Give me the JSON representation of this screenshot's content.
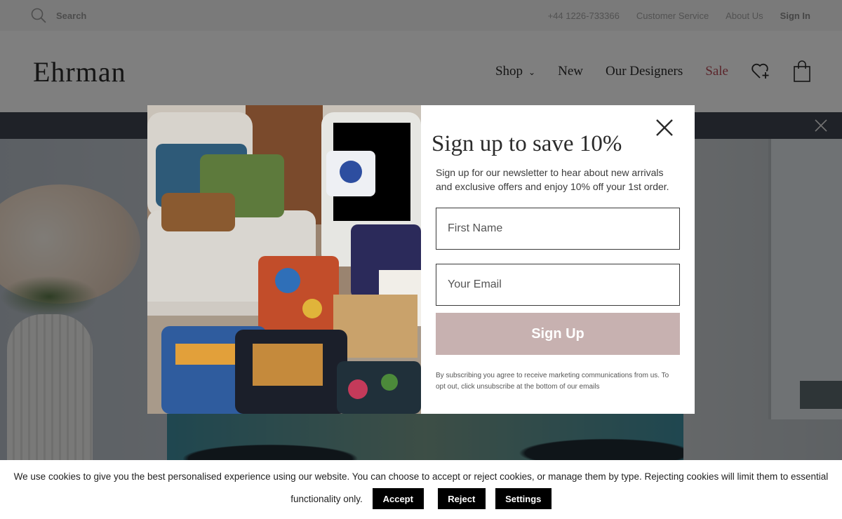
{
  "topbar": {
    "search_label": "Search",
    "phone": "+44 1226-733366",
    "customer_service": "Customer Service",
    "about_us": "About Us",
    "sign_in": "Sign In"
  },
  "header": {
    "logo": "Ehrman",
    "nav": {
      "shop": "Shop",
      "new": "New",
      "designers": "Our Designers",
      "sale": "Sale"
    },
    "icons": [
      "search-icon",
      "chevron-down-icon",
      "heart-plus-icon",
      "shopping-bag-icon",
      "close-icon"
    ]
  },
  "modal": {
    "title": "Sign up to save 10%",
    "subtitle": "Sign up for our newsletter to hear about new arrivals and exclusive offers and enjoy 10% off your 1st order.",
    "first_name_placeholder": "First Name",
    "email_placeholder": "Your Email",
    "signup_label": "Sign Up",
    "fineprint": "By subscribing you agree to receive marketing communications from us. To opt out, click unsubscribe at the bottom of our emails"
  },
  "cookie": {
    "text_line1": "We use cookies to give you the best personalised experience using our website. You can choose to accept or reject cookies, or manage them by type. Rejecting cookies will limit them to essential",
    "text_line2": "functionality only.",
    "accept": "Accept",
    "reject": "Reject",
    "settings": "Settings"
  },
  "colors": {
    "sale": "#b74b56",
    "signup_button": "#c7b1b0",
    "promo_bar": "#3f4450",
    "cookie_button": "#000000"
  }
}
